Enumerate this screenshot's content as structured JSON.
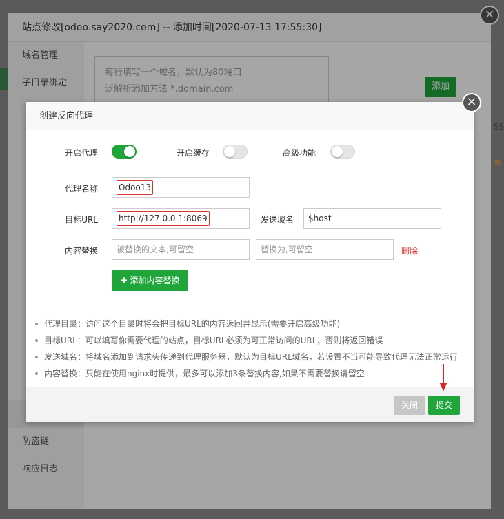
{
  "outer": {
    "title": "站点修改[odoo.say2020.com] -- 添加时间[2020-07-13 17:55:30]",
    "sidebar": [
      "域名管理",
      "子目录绑定",
      "",
      "",
      "",
      "",
      "",
      "",
      "",
      "",
      "",
      "",
      "",
      "",
      "防盗链",
      "响应日志"
    ],
    "textarea_lines": [
      "每行填写一个域名，默认为80端口",
      "泛解析添加方法 *.domain.com",
      ""
    ],
    "add_label": "添加",
    "right_texts": [
      "SS",
      "未"
    ]
  },
  "modal": {
    "title": "创建反向代理",
    "toggles": {
      "proxy_label": "开启代理",
      "cache_label": "开启缓存",
      "advanced_label": "高级功能"
    },
    "proxy_name_label": "代理名称",
    "proxy_name_value": "Odoo13",
    "target_url_label": "目标URL",
    "target_url_value": "http://127.0.0.1:8069",
    "send_domain_label": "发送域名",
    "send_domain_value": "$host",
    "replace_label": "内容替换",
    "replace_from_placeholder": "被替换的文本,可留空",
    "replace_to_placeholder": "替换为,可留空",
    "delete_label": "删除",
    "add_replace_label": "添加内容替换",
    "tips": [
      "代理目录：访问这个目录时将会把目标URL的内容返回并显示(需要开启高级功能)",
      "目标URL：可以填写你需要代理的站点，目标URL必须为可正常访问的URL，否则将返回错误",
      "发送域名：将域名添加到请求头传递到代理服务器，默认为目标URL域名，若设置不当可能导致代理无法正常运行",
      "内容替换：只能在使用nginx时提供，最多可以添加3条替换内容,如果不需要替换请留空"
    ],
    "close_label": "关闭",
    "submit_label": "提交"
  },
  "colors": {
    "accent": "#20a53a",
    "danger": "#d9352f"
  }
}
